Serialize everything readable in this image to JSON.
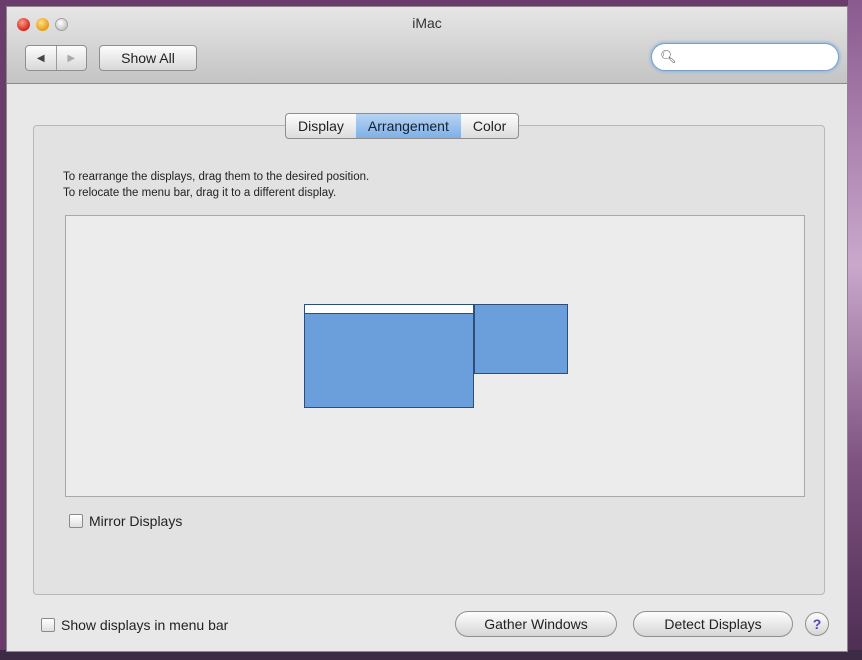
{
  "window": {
    "title": "iMac"
  },
  "toolbar": {
    "back_glyph": "◀",
    "forward_glyph": "▶",
    "show_all_label": "Show All",
    "search_placeholder": "",
    "search_value": ""
  },
  "tabs": [
    {
      "label": "Display",
      "active": false
    },
    {
      "label": "Arrangement",
      "active": true
    },
    {
      "label": "Color",
      "active": false
    }
  ],
  "instructions": {
    "line1": "To rearrange the displays, drag them to the desired position.",
    "line2": "To relocate the menu bar, drag it to a different display."
  },
  "displays": [
    {
      "name": "main-display",
      "has_menu_bar": true,
      "color": "#6a9fdc"
    },
    {
      "name": "secondary-display",
      "has_menu_bar": false,
      "color": "#6a9fdc"
    }
  ],
  "mirror_displays": {
    "label": "Mirror Displays",
    "checked": false
  },
  "show_in_menu_bar": {
    "label": "Show displays in menu bar",
    "checked": false
  },
  "buttons": {
    "gather_windows": "Gather Windows",
    "detect_displays": "Detect Displays",
    "help": "?"
  },
  "colors": {
    "accent_tab": "#7fb0e6",
    "display_fill": "#6a9fdc",
    "search_glow": "#8fb5dd"
  }
}
